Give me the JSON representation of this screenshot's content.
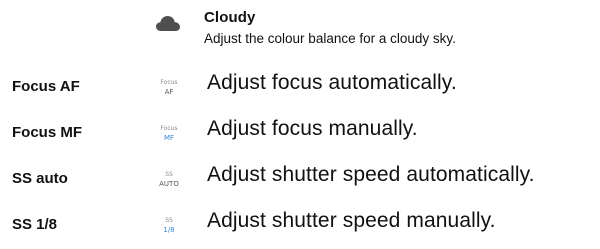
{
  "cloudy": {
    "icon": "cloud-icon",
    "title": "Cloudy",
    "description": "Adjust the colour balance for a cloudy sky."
  },
  "rows": [
    {
      "label": "Focus AF",
      "icon": "focus-af-icon",
      "icon_top": "Focus",
      "icon_bottom": "AF",
      "icon_bottom_color": "#555555",
      "description": "Adjust focus automatically."
    },
    {
      "label": "Focus MF",
      "icon": "focus-mf-icon",
      "icon_top": "Focus",
      "icon_bottom": "MF",
      "icon_bottom_color": "#3a86d6",
      "description": "Adjust focus manually."
    },
    {
      "label": "SS auto",
      "icon": "shutter-speed-auto-icon",
      "icon_top": "SS",
      "icon_bottom": "AUTO",
      "icon_bottom_color": "#555555",
      "description": "Adjust shutter speed automatically."
    },
    {
      "label": "SS 1/8",
      "icon": "shutter-speed-manual-icon",
      "icon_top": "SS",
      "icon_bottom": "1/8",
      "icon_bottom_color": "#3a86d6",
      "description": "Adjust shutter speed manually."
    }
  ]
}
